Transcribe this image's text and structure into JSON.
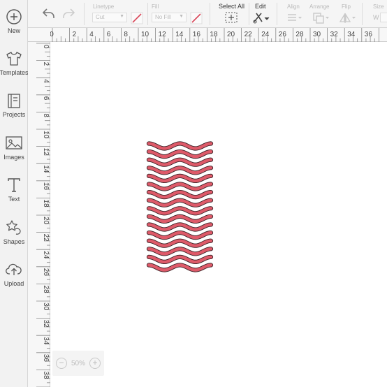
{
  "sidebar": {
    "items": [
      {
        "label": "New",
        "icon": "plus-circle-icon"
      },
      {
        "label": "Templates",
        "icon": "tshirt-icon"
      },
      {
        "label": "Projects",
        "icon": "book-icon"
      },
      {
        "label": "Images",
        "icon": "image-icon"
      },
      {
        "label": "Text",
        "icon": "text-t-icon"
      },
      {
        "label": "Shapes",
        "icon": "shapes-icon"
      },
      {
        "label": "Upload",
        "icon": "cloud-upload-icon"
      }
    ]
  },
  "toolbar": {
    "linetype_label": "Linetype",
    "linetype_value": "Cut",
    "fill_label": "Fill",
    "fill_value": "No Fill",
    "select_all_label": "Select All",
    "edit_label": "Edit",
    "align_label": "Align",
    "arrange_label": "Arrange",
    "flip_label": "Flip",
    "size_label": "Size",
    "size_w": "W"
  },
  "ruler": {
    "top": [
      "0",
      "2",
      "4",
      "6",
      "8",
      "10",
      "12",
      "14",
      "16",
      "18",
      "20",
      "22",
      "24",
      "26",
      "28",
      "30",
      "32",
      "34",
      "36"
    ],
    "left": [
      "0",
      "2",
      "4",
      "6",
      "8",
      "10",
      "12",
      "14",
      "16",
      "18",
      "20",
      "22",
      "24",
      "26",
      "28",
      "30",
      "32",
      "34",
      "36",
      "38"
    ]
  },
  "zoom": {
    "value": "50%",
    "minus": "−",
    "plus": "+"
  },
  "colors": {
    "accent": "#d9475a",
    "shape_fill": "#de5a69",
    "shape_stroke": "#3a2226"
  },
  "design": {
    "wave_count": 16
  }
}
